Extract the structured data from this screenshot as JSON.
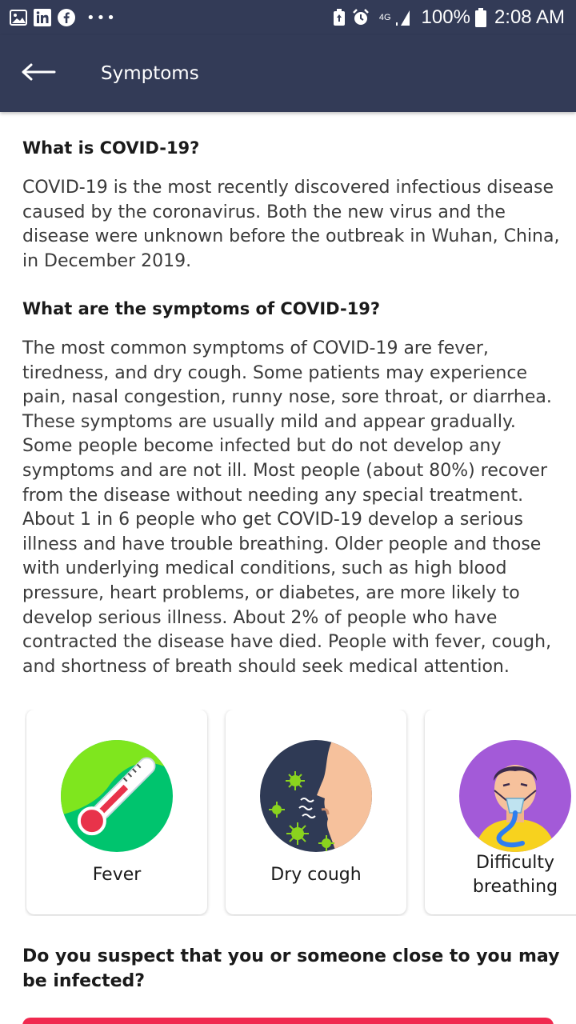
{
  "status_bar": {
    "network": "4G",
    "battery": "100%",
    "time": "2:08 AM",
    "icons": [
      "gallery-icon",
      "linkedin-icon",
      "facebook-icon",
      "more-dots-icon",
      "battery-saver-icon",
      "alarm-icon",
      "signal-icon",
      "battery-icon"
    ]
  },
  "app_bar": {
    "title": "Symptoms",
    "back_icon": "back-arrow-icon"
  },
  "sections": [
    {
      "heading": "What is COVID-19?",
      "body": "COVID-19 is the most recently discovered infectious disease caused by the coronavirus. Both the new virus and the disease were unknown before the outbreak in Wuhan, China, in December 2019."
    },
    {
      "heading": "What are the symptoms of COVID-19?",
      "body": "The most common symptoms of COVID-19 are fever, tiredness, and dry cough. Some patients may experience pain, nasal congestion, runny nose, sore throat, or diarrhea. These symptoms are usually mild and appear gradually. Some people become infected but do not develop any symptoms and are not ill. Most people (about 80%) recover from the disease without needing any special treatment. About 1 in 6 people who get COVID-19 develop a serious illness and have trouble breathing. Older people and those with underlying medical conditions, such as high blood pressure, heart problems, or diabetes, are more likely to develop serious illness. About 2% of people who have contracted the disease have died. People with fever, cough, and shortness of breath should seek medical attention."
    }
  ],
  "symptom_cards": [
    {
      "label": "Fever",
      "icon": "thermometer-icon"
    },
    {
      "label": "Dry cough",
      "icon": "cough-icon"
    },
    {
      "label": "Difficulty breathing",
      "icon": "oxygen-mask-icon"
    }
  ],
  "bottom_question": "Do you suspect that you or someone close to you may be infected?",
  "colors": {
    "app_bar": "#333b57",
    "accent": "#f0294f",
    "text": "#1a1a1a"
  }
}
